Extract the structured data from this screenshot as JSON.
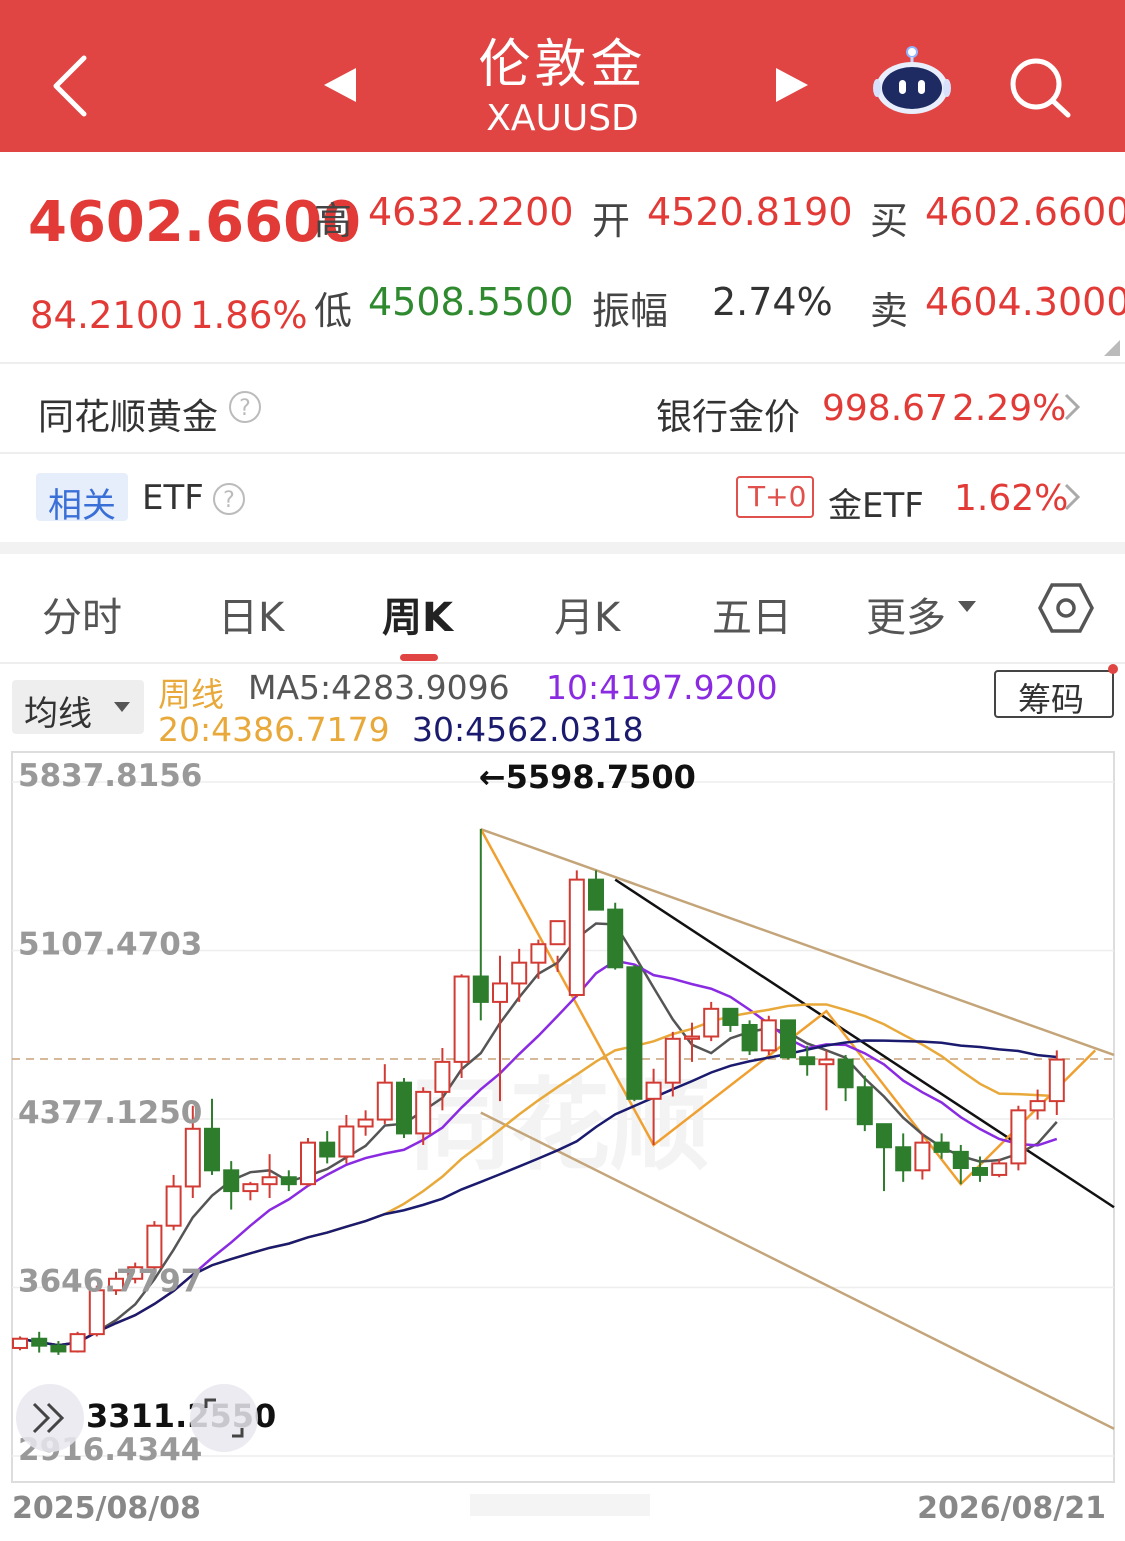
{
  "header": {
    "title": "伦敦金",
    "subtitle": "XAUUSD",
    "icons": [
      "back-arrow-icon",
      "prev-triangle-icon",
      "next-triangle-icon",
      "robot-assistant-icon",
      "search-icon"
    ],
    "color": "#e04543"
  },
  "quote": {
    "price": "4602.6600",
    "change": "84.2100",
    "change_pct": "1.86%",
    "high_label": "高",
    "high": "4632.2200",
    "open_label": "开",
    "open": "4520.8190",
    "buy_label": "买",
    "buy": "4602.6600",
    "low_label": "低",
    "low": "4508.5500",
    "amp_label": "振幅",
    "amp": "2.74%",
    "sell_label": "卖",
    "sell": "4604.3000"
  },
  "row_gold": {
    "label": "同花顺黄金",
    "bank_label": "银行金价",
    "bank_value": "998.67",
    "bank_pct": "2.29%"
  },
  "row_etf": {
    "tag": "相关",
    "label": "ETF",
    "badge": "T+0",
    "etf_label": "金ETF",
    "etf_pct": "1.62%"
  },
  "tabs": {
    "items": [
      "分时",
      "日K",
      "周K",
      "月K",
      "五日",
      "更多"
    ],
    "active": "周K"
  },
  "indicators": {
    "selector": "均线",
    "period": "周线",
    "ma5": "MA5:4283.9096",
    "ma10": "10:4197.9200",
    "ma20": "20:4386.7179",
    "ma30": "30:4562.0318",
    "chip_button": "筹码"
  },
  "chart_data": {
    "type": "candlestick",
    "y_ticks": [
      "5837.8156",
      "5107.4703",
      "4377.1250",
      "3646.7797",
      "2916.4344"
    ],
    "ylim": [
      2916.4344,
      5837.8156
    ],
    "max_annotation": "←5598.7500",
    "min_annotation": "3311.2550",
    "current_price_line": 4602.66,
    "x_start": "2025/08/08",
    "x_end": "2026/08/21",
    "colors": {
      "up": "#d23b34",
      "down": "#2d7d2d",
      "ma5": "#555555",
      "ma10": "#8a2be2",
      "ma20": "#e8a93a",
      "ma30": "#1a1a6e",
      "trend_tan": "#c4a57a",
      "trend_orange": "#f0a030",
      "trend_black": "#111111"
    },
    "candles": [
      [
        3350,
        3400,
        3340,
        3390
      ],
      [
        3390,
        3420,
        3330,
        3360
      ],
      [
        3360,
        3380,
        3320,
        3335
      ],
      [
        3335,
        3420,
        3330,
        3410
      ],
      [
        3410,
        3620,
        3400,
        3600
      ],
      [
        3600,
        3680,
        3580,
        3650
      ],
      [
        3650,
        3720,
        3630,
        3700
      ],
      [
        3700,
        3900,
        3690,
        3880
      ],
      [
        3880,
        4100,
        3860,
        4050
      ],
      [
        4050,
        4400,
        4000,
        4300
      ],
      [
        4300,
        4430,
        4100,
        4120
      ],
      [
        4120,
        4160,
        3950,
        4030
      ],
      [
        4030,
        4070,
        3990,
        4060
      ],
      [
        4060,
        4190,
        4000,
        4090
      ],
      [
        4090,
        4120,
        4030,
        4060
      ],
      [
        4060,
        4260,
        4050,
        4240
      ],
      [
        4240,
        4290,
        4150,
        4180
      ],
      [
        4180,
        4360,
        4150,
        4310
      ],
      [
        4310,
        4380,
        4270,
        4340
      ],
      [
        4340,
        4580,
        4320,
        4500
      ],
      [
        4500,
        4520,
        4260,
        4280
      ],
      [
        4280,
        4480,
        4230,
        4460
      ],
      [
        4460,
        4650,
        4380,
        4590
      ],
      [
        4590,
        4970,
        4520,
        4960
      ],
      [
        4960,
        5600,
        4770,
        4850
      ],
      [
        4850,
        5050,
        4420,
        4930
      ],
      [
        4930,
        5080,
        4850,
        5020
      ],
      [
        5020,
        5120,
        4950,
        5100
      ],
      [
        5100,
        5050,
        4980,
        5200
      ],
      [
        4880,
        5420,
        4870,
        5380
      ],
      [
        5380,
        5420,
        5250,
        5250
      ],
      [
        5250,
        5280,
        4990,
        5000
      ],
      [
        5000,
        5010,
        4420,
        4430
      ],
      [
        4430,
        4560,
        4230,
        4500
      ],
      [
        4500,
        4720,
        4440,
        4690
      ],
      [
        4690,
        4760,
        4590,
        4700
      ],
      [
        4700,
        4850,
        4680,
        4820
      ],
      [
        4820,
        4820,
        4720,
        4750
      ],
      [
        4750,
        4770,
        4620,
        4640
      ],
      [
        4640,
        4790,
        4620,
        4770
      ],
      [
        4770,
        4760,
        4600,
        4610
      ],
      [
        4610,
        4660,
        4530,
        4580
      ],
      [
        4580,
        4640,
        4380,
        4600
      ],
      [
        4600,
        4620,
        4420,
        4480
      ],
      [
        4480,
        4530,
        4290,
        4320
      ],
      [
        4320,
        4310,
        4030,
        4220
      ],
      [
        4220,
        4280,
        4070,
        4120
      ],
      [
        4120,
        4280,
        4080,
        4240
      ],
      [
        4240,
        4280,
        4170,
        4200
      ],
      [
        4200,
        4230,
        4060,
        4130
      ],
      [
        4130,
        4180,
        4070,
        4100
      ],
      [
        4100,
        4170,
        4090,
        4150
      ],
      [
        4150,
        4400,
        4120,
        4380
      ],
      [
        4380,
        4470,
        4340,
        4420
      ],
      [
        4420,
        4640,
        4360,
        4600
      ]
    ]
  }
}
